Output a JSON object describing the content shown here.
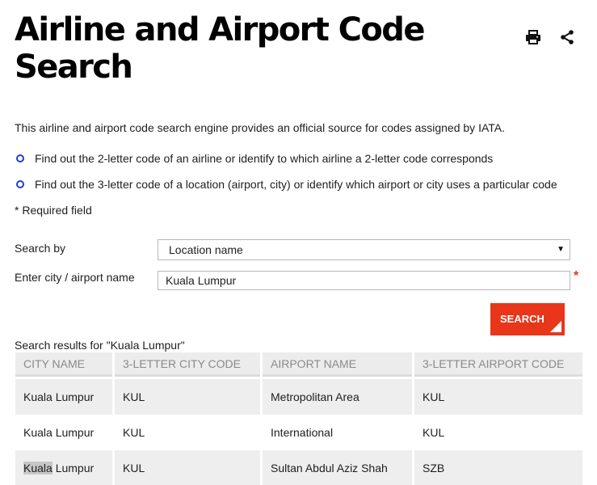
{
  "page": {
    "title": "Airline and Airport Code Search",
    "intro": "This airline and airport code search engine provides an official source for codes assigned by IATA.",
    "bullets": [
      "Find out the 2-letter code of an airline or identify to which airline a 2-letter code corresponds",
      "Find out the 3-letter code of a location (airport, city) or identify which airport or city uses a particular code"
    ],
    "required_note": "* Required field"
  },
  "icons": {
    "print": "printer-icon",
    "share": "share-icon"
  },
  "form": {
    "search_by_label": "Search by",
    "search_by_value": "Location name",
    "city_label": "Enter city / airport name",
    "city_value": "Kuala Lumpur",
    "required_marker": "*",
    "search_button": "SEARCH"
  },
  "results": {
    "caption": "Search results for \"Kuala Lumpur\"",
    "columns": [
      "CITY NAME",
      "3-LETTER CITY CODE",
      "AIRPORT NAME",
      "3-LETTER AIRPORT CODE"
    ],
    "rows": [
      {
        "city_highlight": "",
        "city": "Kuala Lumpur",
        "city_code": "KUL",
        "airport": "Metropolitan Area",
        "airport_code": "KUL"
      },
      {
        "city_highlight": "",
        "city": "Kuala Lumpur",
        "city_code": "KUL",
        "airport": "International",
        "airport_code": "KUL"
      },
      {
        "city_highlight": "Kuala",
        "city": " Lumpur",
        "city_code": "KUL",
        "airport": "Sultan Abdul Aziz Shah",
        "airport_code": "SZB"
      }
    ]
  },
  "colors": {
    "accent": "#e8361b",
    "bullet": "#1d3fd8",
    "header_bg": "#ececec",
    "row_alt": "#eeeeee"
  }
}
